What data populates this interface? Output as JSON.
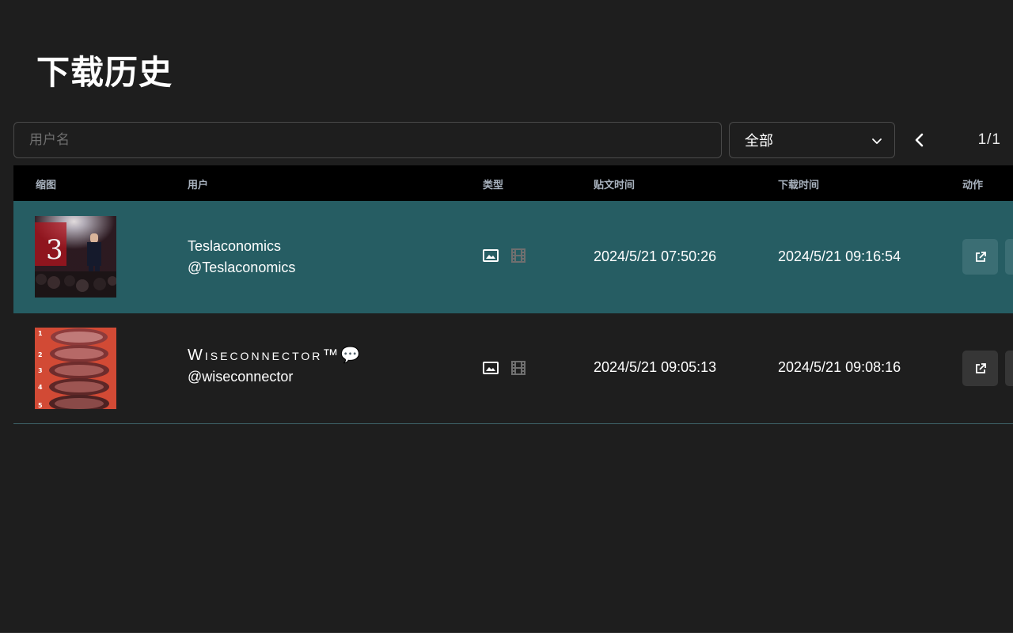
{
  "page": {
    "title": "下载历史"
  },
  "filters": {
    "search_placeholder": "用户名",
    "type_select_value": "全部",
    "pagination": "1/1"
  },
  "table": {
    "headers": {
      "thumbnail": "缩图",
      "user": "用户",
      "type": "类型",
      "post_time": "贴文时间",
      "download_time": "下载时间",
      "actions": "动作"
    },
    "rows": [
      {
        "name": "Teslaconomics",
        "handle": "@Teslaconomics",
        "post_time": "2024/5/21 07:50:26",
        "download_time": "2024/5/21 09:16:54",
        "thumbnail_icon": "stage-photo",
        "selected": true
      },
      {
        "name": "Wiseconnector™💬",
        "handle": "@wiseconnector",
        "post_time": "2024/5/21 09:05:13",
        "download_time": "2024/5/21 09:08:16",
        "thumbnail_icon": "steak-photo",
        "selected": false
      }
    ]
  },
  "colors": {
    "background": "#1e1e1e",
    "header_bg": "#000000",
    "selected_row": "#265d63",
    "muted_icon": "#6f6f6f"
  }
}
